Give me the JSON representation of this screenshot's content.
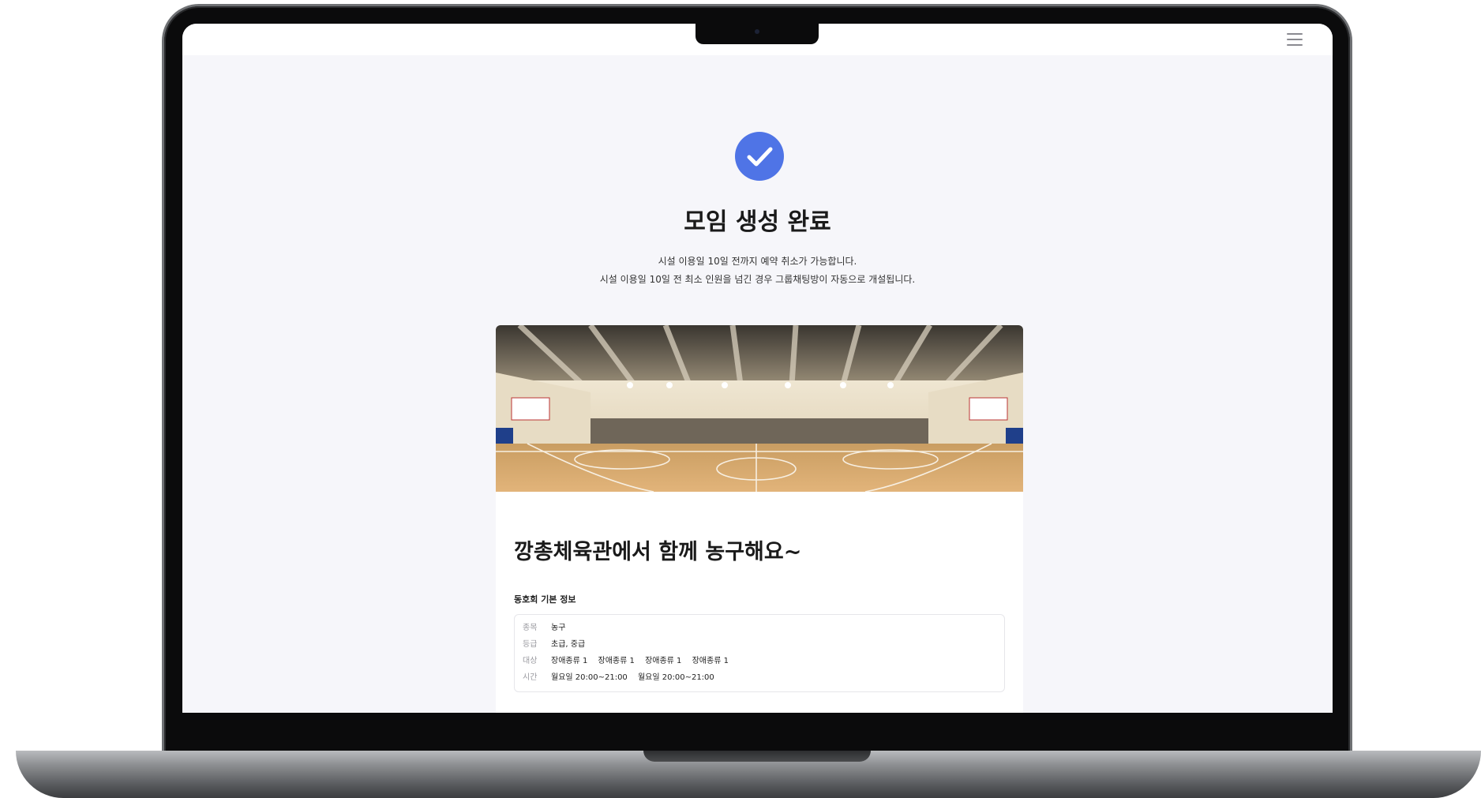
{
  "header": {
    "menu_icon": "hamburger-menu-icon"
  },
  "completion": {
    "icon": "check-circle-icon",
    "icon_color": "#4f74e6",
    "title": "모임 생성 완료",
    "notice_1": "시설 이용일 10일 전까지 예약 취소가 가능합니다.",
    "notice_2": "시설 이용일 10일 전 최소 인원을 넘긴 경우 그룹채팅방이 자동으로 개설됩니다."
  },
  "meeting": {
    "title": "깡총체육관에서 함께 농구해요~",
    "section_title": "동호회 기본 정보",
    "info": {
      "sport": {
        "label": "종목",
        "value": "농구"
      },
      "level": {
        "label": "등급",
        "value": "초급, 중급"
      },
      "target": {
        "label": "대상",
        "values": [
          "장애종류 1",
          "장애종류 1",
          "장애종류 1",
          "장애종류 1"
        ]
      },
      "time": {
        "label": "시간",
        "values": [
          "월요일 20:00~21:00",
          "월요일 20:00~21:00"
        ]
      }
    }
  }
}
